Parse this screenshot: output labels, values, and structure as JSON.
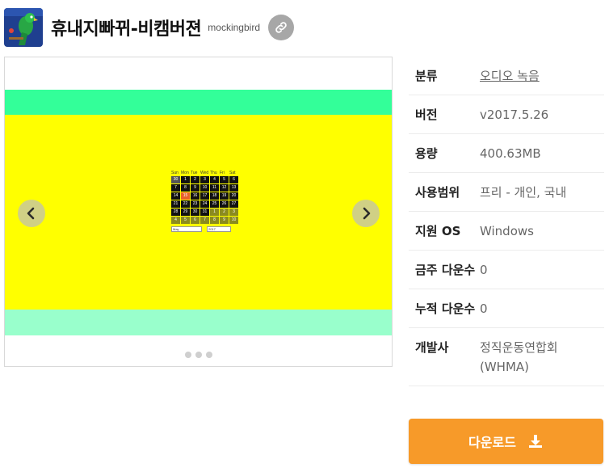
{
  "app": {
    "title": "휴내지빠뀌-비캠버젼",
    "author": "mockingbird",
    "icon": "parrot-app-icon"
  },
  "header": {
    "link_icon": "link-icon"
  },
  "gallery": {
    "prev_icon": "chevron-left-icon",
    "next_icon": "chevron-right-icon",
    "slide_count": 3,
    "colors": {
      "top": "#33ff99",
      "mid": "#ffff00",
      "bottom": "#99ffcc"
    },
    "calendar": {
      "weekdays": [
        "Sun",
        "Mon",
        "Tue",
        "Wed",
        "Thu",
        "Fri",
        "Sat"
      ],
      "days": [
        "30",
        "1",
        "2",
        "3",
        "4",
        "5",
        "6",
        "7",
        "8",
        "9",
        "10",
        "11",
        "12",
        "13",
        "14",
        "15",
        "16",
        "17",
        "18",
        "19",
        "20",
        "21",
        "22",
        "23",
        "24",
        "25",
        "26",
        "27",
        "28",
        "29",
        "30",
        "31",
        "1",
        "2",
        "3",
        "4",
        "5",
        "6",
        "7",
        "8",
        "9",
        "10"
      ],
      "month": "May",
      "year": "2017"
    }
  },
  "info": [
    {
      "label": "분류",
      "value": "오디오 녹음",
      "link": true
    },
    {
      "label": "버전",
      "value": "v2017.5.26"
    },
    {
      "label": "용량",
      "value": "400.63MB"
    },
    {
      "label": "사용범위",
      "value": "프리 - 개인, 국내"
    },
    {
      "label": "지원 OS",
      "value": "Windows"
    },
    {
      "label": "금주 다운수",
      "value": "0"
    },
    {
      "label": "누적 다운수",
      "value": "0"
    },
    {
      "label": "개발사",
      "value": "정직운동연합회(WHMA)"
    }
  ],
  "download": {
    "label": "다운로드",
    "icon": "download-icon",
    "color": "#f79a29"
  }
}
